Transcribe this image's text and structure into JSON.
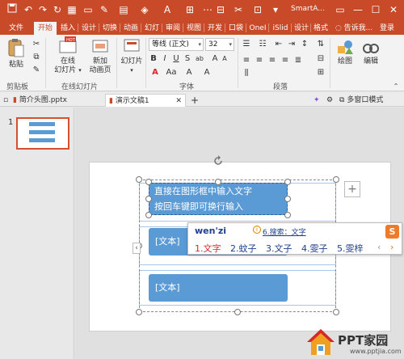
{
  "window": {
    "title": "SmartA...",
    "controls": {
      "restore": "▭",
      "minimize": "—",
      "maximize": "☐",
      "close": "✕"
    }
  },
  "qat": {
    "save": "💾",
    "undo": "↶",
    "redo": "↷",
    "customize": "▾"
  },
  "tabs": [
    "文件",
    "开始",
    "插入",
    "设计",
    "切换",
    "动画",
    "幻灯",
    "审阅",
    "视图",
    "开发",
    "口袋",
    "OneI",
    "iSlid",
    "设计",
    "格式",
    "告诉我...",
    "登录"
  ],
  "ribbon": {
    "paste": "粘贴",
    "new_slide_line1": "在线",
    "new_slide_line2": "幻灯片",
    "new_anim_line1": "新加",
    "new_anim_line2": "动画页",
    "slide_btn": "幻灯片",
    "font_name": "等线 (正文)",
    "font_size": "32",
    "bold": "B",
    "italic": "I",
    "underline": "U",
    "strike": "S",
    "draw": "绘图",
    "edit": "编辑",
    "groups": {
      "clipboard": "剪贴板",
      "online_slides": "在线幻灯片",
      "font": "字体",
      "paragraph": "段落"
    }
  },
  "doc_tabs": [
    {
      "label": "简介头图.pptx",
      "active": false
    },
    {
      "label": "演示文稿1",
      "active": true
    }
  ],
  "doc_add": "+",
  "multi_window": "多窗口模式",
  "thumbnail": {
    "number": "1"
  },
  "slide": {
    "editing_text_line1": "直接在图形框中输入文字",
    "editing_text_line2": "按回车键即可换行输入",
    "box2_text": "[文本]",
    "box3_text": "[文本]",
    "add_button": "+",
    "nav_left": "‹"
  },
  "ime": {
    "input": "wen'zi",
    "search": "6.搜索：文字",
    "candidates": [
      "1.文字",
      "2.蚊子",
      "3.文子",
      "4.雯子",
      "5.雯梓"
    ],
    "prev": "‹",
    "next": "›",
    "logo": "S"
  },
  "watermark": {
    "title": "PPT家园",
    "url": "www.pptjia.com"
  },
  "colors": {
    "brand": "#c84a28",
    "shape_blue": "#5b9bd5",
    "thumb_border": "#d5502c"
  }
}
